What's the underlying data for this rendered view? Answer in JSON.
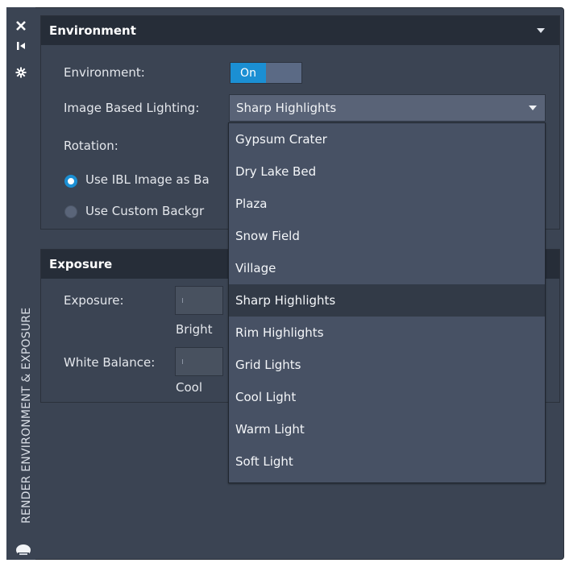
{
  "sidebar": {
    "close_icon": "x-icon",
    "pin_icon": "pin-icon",
    "settings_icon": "gear-icon",
    "title": "RENDER ENVIRONMENT & EXPOSURE",
    "bulb_icon": "lightbulb-icon"
  },
  "environment": {
    "title": "Environment",
    "env_label": "Environment:",
    "toggle_value": "On",
    "ibl_label": "Image Based Lighting:",
    "ibl_value": "Sharp Highlights",
    "rotation_label": "Rotation:",
    "radio_ibl_label": "Use IBL Image as Ba",
    "radio_custom_label": "Use Custom Backgr",
    "radio_selected": "Use IBL Image as Background"
  },
  "exposure": {
    "title": "Exposure",
    "exposure_label": "Exposure:",
    "exposure_hint": "Bright",
    "white_balance_label": "White Balance:",
    "white_balance_hint": "Cool"
  },
  "dropdown": {
    "items": [
      "Gypsum Crater",
      "Dry Lake Bed",
      "Plaza",
      "Snow Field",
      "Village",
      "Sharp Highlights",
      "Rim Highlights",
      "Grid Lights",
      "Cool Light",
      "Warm Light",
      "Soft Light"
    ],
    "selected": "Sharp Highlights"
  },
  "colors": {
    "panel_bg": "#3b4453",
    "header_bg": "#262d38",
    "accent": "#1b8fd3",
    "dropdown_bg": "#475164",
    "selected_bg": "#323a47"
  }
}
